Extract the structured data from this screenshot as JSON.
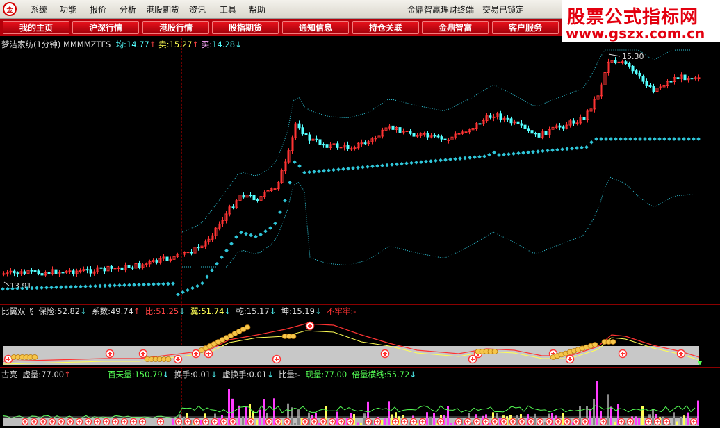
{
  "menubar": {
    "items": [
      "系统",
      "功能",
      "报价",
      "分析",
      "港股期货",
      "资讯",
      "工具",
      "帮助"
    ],
    "title": "金鼎智赢理财终端 - 交易已锁定"
  },
  "brand": {
    "line1": "股票公式指标网",
    "line2": "www.gszx.com.cn"
  },
  "navbar": {
    "buttons": [
      "我的主页",
      "沪深行情",
      "港股行情",
      "股指期货",
      "通知信息",
      "持仓关联",
      "金鼎智富",
      "客户服务"
    ]
  },
  "main_panel": {
    "name": "梦洁家纺(1分钟) MMMMZTFS",
    "avg_label": "均:",
    "avg": "14.77",
    "sell_label": "卖:",
    "sell": "15.27",
    "buy_label": "买:",
    "buy": "14.28",
    "high_marker": "15.30",
    "low_marker": "13.91"
  },
  "indicator_panel": {
    "name": "比翼双飞",
    "baoxian_label": "保险:",
    "baoxian": "52.82",
    "xishu_label": "系数:",
    "xishu": "49.74",
    "bi_label": "比:",
    "bi": "51.25",
    "yi_label": "翼:",
    "yi": "51.74",
    "qian_label": "乾:",
    "qian": "15.17",
    "kun_label": "坤:",
    "kun": "15.19",
    "bulao_label": "不牢牢:",
    "bulao": "-"
  },
  "volume_panel": {
    "name": "古亮",
    "xuliang_label": "虚量:",
    "xuliang": "77.00",
    "baitian_label": "百天量:",
    "baitian": "150.79",
    "huanshou_label": "换手:",
    "huanshou": "0.01",
    "xuhuanshou_label": "虚换手:",
    "xuhuanshou": "0.01",
    "biliang_label": "比量:",
    "biliang": "-",
    "xianliang_label": "现量:",
    "xianliang": "77.00",
    "beiliang_label": "倍量横线:",
    "beiliang": "55.72"
  },
  "colors": {
    "up": "#ff3333",
    "down": "#54ffff",
    "dots": "#2fc6d9",
    "grid": "#8b0000",
    "magenta": "#ff3cff",
    "yellow": "#ffff55",
    "green": "#55ff55"
  }
}
